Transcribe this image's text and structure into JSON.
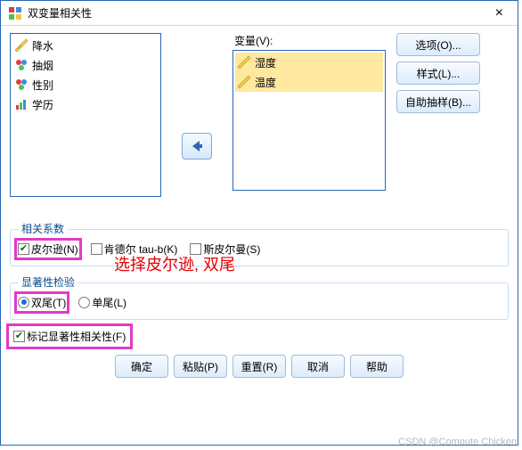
{
  "titlebar": {
    "title": "双变量相关性",
    "close": "×"
  },
  "vars_label": "变量(V):",
  "left_items": [
    {
      "label": "降水",
      "icon": "ruler"
    },
    {
      "label": "抽烟",
      "icon": "beads"
    },
    {
      "label": "性别",
      "icon": "beads"
    },
    {
      "label": "学历",
      "icon": "chart"
    }
  ],
  "right_items": [
    {
      "label": "湿度",
      "icon": "ruler",
      "selected": true
    },
    {
      "label": "温度",
      "icon": "ruler",
      "selected": true
    }
  ],
  "side_buttons": {
    "options": "选项(O)...",
    "style": "样式(L)...",
    "bootstrap": "自助抽样(B)..."
  },
  "annotation": "选择皮尔逊, 双尾",
  "group_corr": {
    "legend": "相关系数",
    "pearson": "皮尔逊(N)",
    "kendall": "肯德尔 tau-b(K)",
    "spearman": "斯皮尔曼(S)"
  },
  "group_sig": {
    "legend": "显著性检验",
    "two": "双尾(T)",
    "one": "单尾(L)"
  },
  "flag": "标记显著性相关性(F)",
  "buttons": {
    "ok": "确定",
    "paste": "粘贴(P)",
    "reset": "重置(R)",
    "cancel": "取消",
    "help": "帮助"
  },
  "watermark": "CSDN @Compute Chicken"
}
